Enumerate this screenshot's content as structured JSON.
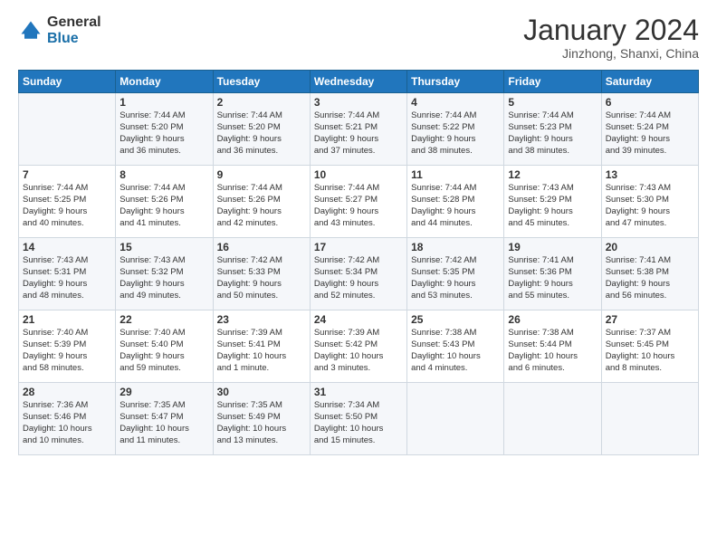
{
  "logo": {
    "general": "General",
    "blue": "Blue"
  },
  "title": "January 2024",
  "subtitle": "Jinzhong, Shanxi, China",
  "header_days": [
    "Sunday",
    "Monday",
    "Tuesday",
    "Wednesday",
    "Thursday",
    "Friday",
    "Saturday"
  ],
  "weeks": [
    [
      {
        "day": "",
        "info": ""
      },
      {
        "day": "1",
        "info": "Sunrise: 7:44 AM\nSunset: 5:20 PM\nDaylight: 9 hours\nand 36 minutes."
      },
      {
        "day": "2",
        "info": "Sunrise: 7:44 AM\nSunset: 5:20 PM\nDaylight: 9 hours\nand 36 minutes."
      },
      {
        "day": "3",
        "info": "Sunrise: 7:44 AM\nSunset: 5:21 PM\nDaylight: 9 hours\nand 37 minutes."
      },
      {
        "day": "4",
        "info": "Sunrise: 7:44 AM\nSunset: 5:22 PM\nDaylight: 9 hours\nand 38 minutes."
      },
      {
        "day": "5",
        "info": "Sunrise: 7:44 AM\nSunset: 5:23 PM\nDaylight: 9 hours\nand 38 minutes."
      },
      {
        "day": "6",
        "info": "Sunrise: 7:44 AM\nSunset: 5:24 PM\nDaylight: 9 hours\nand 39 minutes."
      }
    ],
    [
      {
        "day": "7",
        "info": "Sunrise: 7:44 AM\nSunset: 5:25 PM\nDaylight: 9 hours\nand 40 minutes."
      },
      {
        "day": "8",
        "info": "Sunrise: 7:44 AM\nSunset: 5:26 PM\nDaylight: 9 hours\nand 41 minutes."
      },
      {
        "day": "9",
        "info": "Sunrise: 7:44 AM\nSunset: 5:26 PM\nDaylight: 9 hours\nand 42 minutes."
      },
      {
        "day": "10",
        "info": "Sunrise: 7:44 AM\nSunset: 5:27 PM\nDaylight: 9 hours\nand 43 minutes."
      },
      {
        "day": "11",
        "info": "Sunrise: 7:44 AM\nSunset: 5:28 PM\nDaylight: 9 hours\nand 44 minutes."
      },
      {
        "day": "12",
        "info": "Sunrise: 7:43 AM\nSunset: 5:29 PM\nDaylight: 9 hours\nand 45 minutes."
      },
      {
        "day": "13",
        "info": "Sunrise: 7:43 AM\nSunset: 5:30 PM\nDaylight: 9 hours\nand 47 minutes."
      }
    ],
    [
      {
        "day": "14",
        "info": "Sunrise: 7:43 AM\nSunset: 5:31 PM\nDaylight: 9 hours\nand 48 minutes."
      },
      {
        "day": "15",
        "info": "Sunrise: 7:43 AM\nSunset: 5:32 PM\nDaylight: 9 hours\nand 49 minutes."
      },
      {
        "day": "16",
        "info": "Sunrise: 7:42 AM\nSunset: 5:33 PM\nDaylight: 9 hours\nand 50 minutes."
      },
      {
        "day": "17",
        "info": "Sunrise: 7:42 AM\nSunset: 5:34 PM\nDaylight: 9 hours\nand 52 minutes."
      },
      {
        "day": "18",
        "info": "Sunrise: 7:42 AM\nSunset: 5:35 PM\nDaylight: 9 hours\nand 53 minutes."
      },
      {
        "day": "19",
        "info": "Sunrise: 7:41 AM\nSunset: 5:36 PM\nDaylight: 9 hours\nand 55 minutes."
      },
      {
        "day": "20",
        "info": "Sunrise: 7:41 AM\nSunset: 5:38 PM\nDaylight: 9 hours\nand 56 minutes."
      }
    ],
    [
      {
        "day": "21",
        "info": "Sunrise: 7:40 AM\nSunset: 5:39 PM\nDaylight: 9 hours\nand 58 minutes."
      },
      {
        "day": "22",
        "info": "Sunrise: 7:40 AM\nSunset: 5:40 PM\nDaylight: 9 hours\nand 59 minutes."
      },
      {
        "day": "23",
        "info": "Sunrise: 7:39 AM\nSunset: 5:41 PM\nDaylight: 10 hours\nand 1 minute."
      },
      {
        "day": "24",
        "info": "Sunrise: 7:39 AM\nSunset: 5:42 PM\nDaylight: 10 hours\nand 3 minutes."
      },
      {
        "day": "25",
        "info": "Sunrise: 7:38 AM\nSunset: 5:43 PM\nDaylight: 10 hours\nand 4 minutes."
      },
      {
        "day": "26",
        "info": "Sunrise: 7:38 AM\nSunset: 5:44 PM\nDaylight: 10 hours\nand 6 minutes."
      },
      {
        "day": "27",
        "info": "Sunrise: 7:37 AM\nSunset: 5:45 PM\nDaylight: 10 hours\nand 8 minutes."
      }
    ],
    [
      {
        "day": "28",
        "info": "Sunrise: 7:36 AM\nSunset: 5:46 PM\nDaylight: 10 hours\nand 10 minutes."
      },
      {
        "day": "29",
        "info": "Sunrise: 7:35 AM\nSunset: 5:47 PM\nDaylight: 10 hours\nand 11 minutes."
      },
      {
        "day": "30",
        "info": "Sunrise: 7:35 AM\nSunset: 5:49 PM\nDaylight: 10 hours\nand 13 minutes."
      },
      {
        "day": "31",
        "info": "Sunrise: 7:34 AM\nSunset: 5:50 PM\nDaylight: 10 hours\nand 15 minutes."
      },
      {
        "day": "",
        "info": ""
      },
      {
        "day": "",
        "info": ""
      },
      {
        "day": "",
        "info": ""
      }
    ]
  ]
}
